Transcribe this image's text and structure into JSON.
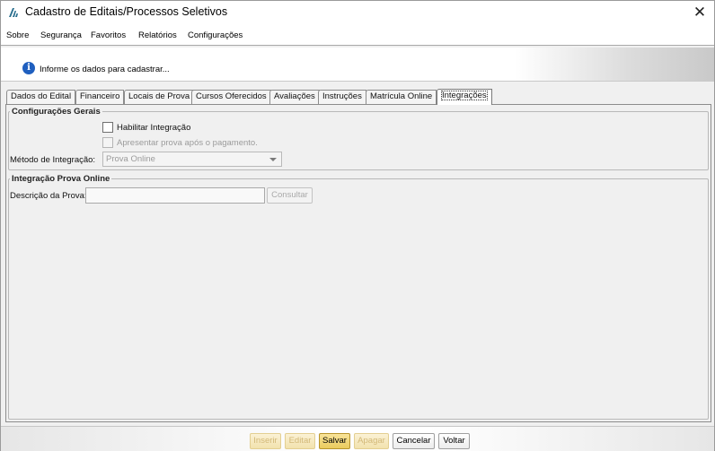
{
  "window": {
    "title": "Cadastro de Editais/Processos Seletivos",
    "close_glyph": "✕",
    "app_icon": "app-logo-icon"
  },
  "menu": {
    "items": [
      "Sobre",
      "Segurança",
      "Favoritos",
      "Relatórios",
      "Configurações"
    ]
  },
  "banner": {
    "icon": "info-icon",
    "icon_glyph": "i",
    "message": "Informe os dados para cadastrar..."
  },
  "tabs": {
    "items": [
      "Dados do Edital",
      "Financeiro",
      "Locais de Prova",
      "Cursos Oferecidos",
      "Avaliações",
      "Instruções",
      "Matrícula Online",
      "Integrações"
    ],
    "active": "Integrações"
  },
  "config_group": {
    "title": "Configurações Gerais",
    "enable_integration_label": "Habilitar Integração",
    "enable_integration_checked": false,
    "show_exam_label": "Apresentar prova após o pagamento.",
    "show_exam_checked": false,
    "method_label": "Método de Integração:",
    "method_value": "Prova Online"
  },
  "online_group": {
    "title": "Integração Prova Online",
    "description_label": "Descrição da Prova:",
    "description_value": "",
    "consult_button": "Consultar"
  },
  "footer": {
    "insert": "Inserir",
    "edit": "Editar",
    "save": "Salvar",
    "delete": "Apagar",
    "cancel": "Cancelar",
    "back": "Voltar"
  },
  "colors": {
    "accent_info": "#1f5fbf",
    "save_button": "#eacb5c",
    "disabled_button_text": "#d2b877"
  }
}
